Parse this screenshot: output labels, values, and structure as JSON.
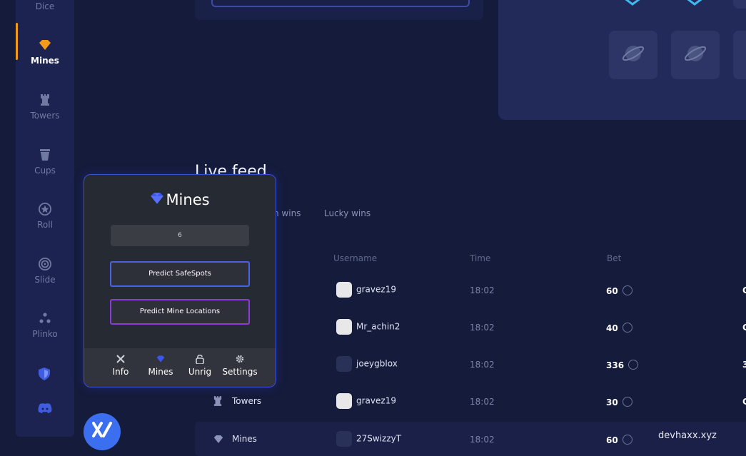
{
  "sidebar": {
    "items": [
      {
        "label": "Dice",
        "icon": "dice-icon"
      },
      {
        "label": "Mines",
        "icon": "diamond-icon"
      },
      {
        "label": "Towers",
        "icon": "tower-icon"
      },
      {
        "label": "Cups",
        "icon": "cup-icon"
      },
      {
        "label": "Roll",
        "icon": "star-circle-icon"
      },
      {
        "label": "Slide",
        "icon": "target-icon"
      },
      {
        "label": "Plinko",
        "icon": "plinko-icon"
      }
    ],
    "active_color": "#f29a1a"
  },
  "live_feed": {
    "title": "Live feed",
    "tabs": [
      "n wins",
      "Lucky wins"
    ],
    "headers": {
      "username": "Username",
      "time": "Time",
      "bet": "Bet"
    },
    "rows": [
      {
        "game": "",
        "username": "gravez19",
        "time": "18:02",
        "bet": "60",
        "tail": "C"
      },
      {
        "game": "",
        "username": "Mr_achin2",
        "time": "18:02",
        "bet": "40",
        "tail": "C"
      },
      {
        "game": "",
        "username": "joeygblox",
        "time": "18:02",
        "bet": "336",
        "tail": "3"
      },
      {
        "game": "Towers",
        "username": "gravez19",
        "time": "18:02",
        "bet": "30",
        "tail": "C"
      },
      {
        "game": "Mines",
        "username": "27SwizzyT",
        "time": "18:02",
        "bet": "60",
        "tail": ""
      }
    ]
  },
  "popup": {
    "title": "Mines",
    "input_value": "6",
    "predict_safespots": "Predict SafeSpots",
    "predict_mines": "Predict Mine Locations",
    "bar": [
      {
        "label": "Info",
        "icon": "tools-icon"
      },
      {
        "label": "Mines",
        "icon": "diamond-icon"
      },
      {
        "label": "Unrig",
        "icon": "unlock-icon"
      },
      {
        "label": "Settings",
        "icon": "gear-icon"
      }
    ]
  },
  "watermark": "devhaxx.xyz"
}
